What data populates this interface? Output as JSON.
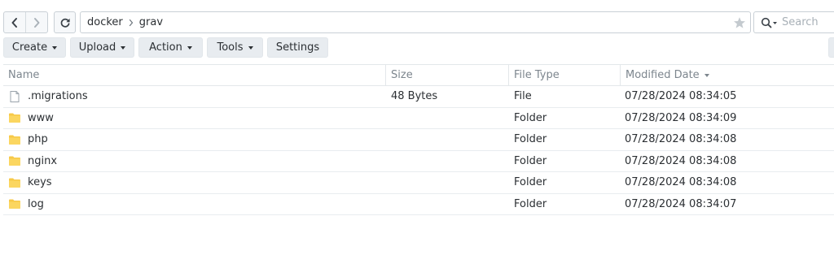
{
  "navigation": {
    "back_icon": "chevron-left-icon",
    "forward_icon": "chevron-right-icon",
    "refresh_icon": "refresh-icon"
  },
  "path": {
    "segments": [
      "docker",
      "grav"
    ],
    "favorite_icon": "star-icon"
  },
  "search": {
    "placeholder": "Search",
    "icon": "search-icon"
  },
  "toolbar": {
    "create_label": "Create",
    "upload_label": "Upload",
    "action_label": "Action",
    "tools_label": "Tools",
    "settings_label": "Settings"
  },
  "table": {
    "columns": {
      "name": "Name",
      "size": "Size",
      "type": "File Type",
      "date": "Modified Date"
    },
    "sort_column": "Modified Date",
    "rows": [
      {
        "name": ".migrations",
        "size": "48 Bytes",
        "type": "File",
        "date": "07/28/2024 08:34:05",
        "icon": "file-icon"
      },
      {
        "name": "www",
        "size": "",
        "type": "Folder",
        "date": "07/28/2024 08:34:09",
        "icon": "folder-icon"
      },
      {
        "name": "php",
        "size": "",
        "type": "Folder",
        "date": "07/28/2024 08:34:08",
        "icon": "folder-icon"
      },
      {
        "name": "nginx",
        "size": "",
        "type": "Folder",
        "date": "07/28/2024 08:34:08",
        "icon": "folder-icon"
      },
      {
        "name": "keys",
        "size": "",
        "type": "Folder",
        "date": "07/28/2024 08:34:08",
        "icon": "folder-icon"
      },
      {
        "name": "log",
        "size": "",
        "type": "Folder",
        "date": "07/28/2024 08:34:07",
        "icon": "folder-icon"
      }
    ]
  },
  "colors": {
    "folder": "#f7c948",
    "toolbar_button": "#e8ecf0",
    "border": "#c9d0d6",
    "header_text": "#7d868e"
  }
}
